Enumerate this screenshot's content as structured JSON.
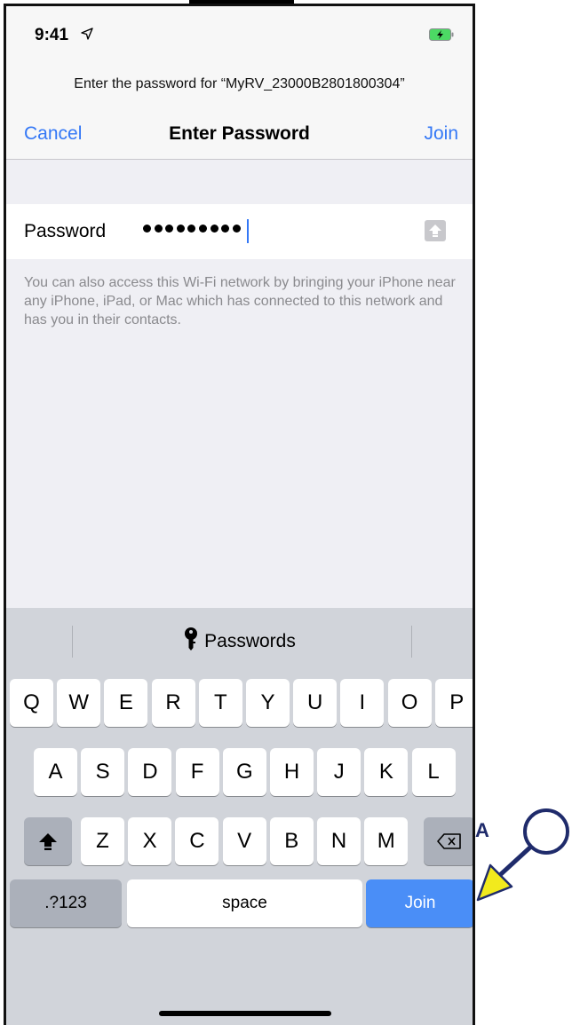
{
  "status_bar": {
    "time": "9:41"
  },
  "prompt_text": "Enter the password for “MyRV_23000B2801800304”",
  "nav": {
    "cancel": "Cancel",
    "title": "Enter Password",
    "join": "Join"
  },
  "password_field": {
    "label": "Password",
    "masked_length": 9
  },
  "hint_text": "You can also access this Wi-Fi network by bringing your iPhone near any iPhone, iPad, or Mac which has connected to this network and has you in their contacts.",
  "keyboard": {
    "suggestion": "Passwords",
    "row1": [
      "Q",
      "W",
      "E",
      "R",
      "T",
      "Y",
      "U",
      "I",
      "O",
      "P"
    ],
    "row2": [
      "A",
      "S",
      "D",
      "F",
      "G",
      "H",
      "J",
      "K",
      "L"
    ],
    "row3": [
      "Z",
      "X",
      "C",
      "V",
      "B",
      "N",
      "M"
    ],
    "numbers_label": ".?123",
    "space_label": "space",
    "join_label": "Join"
  },
  "annotation": {
    "letter": "A"
  },
  "colors": {
    "accent": "#3478f6",
    "join_key": "#4a8ef7",
    "callout_arrow": "#f2ea1d",
    "callout_circle": "#1f2b6b"
  }
}
